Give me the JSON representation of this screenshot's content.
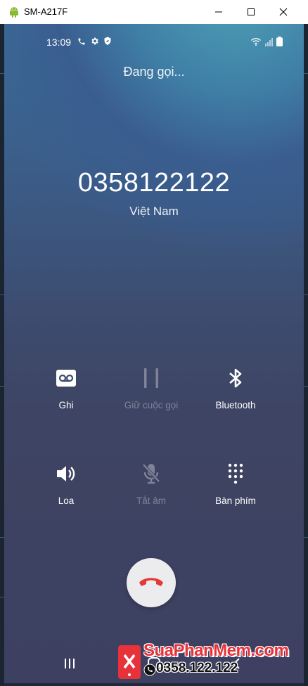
{
  "window": {
    "title": "SM-A217F",
    "icons": [
      "android-icon",
      "minimize-icon",
      "maximize-icon",
      "close-icon"
    ]
  },
  "status_bar": {
    "time": "13:09",
    "icons": [
      "phone-icon",
      "gear-icon",
      "shield-icon",
      "wifi-icon",
      "signal-icon",
      "battery-icon"
    ]
  },
  "call": {
    "state": "Đang gọi...",
    "number": "0358122122",
    "country": "Việt Nam"
  },
  "controls": [
    {
      "label": "Ghi",
      "icon": "voicemail-icon",
      "enabled": true
    },
    {
      "label": "Giữ cuộc gọi",
      "icon": "pause-icon",
      "enabled": false
    },
    {
      "label": "Bluetooth",
      "icon": "bluetooth-icon",
      "enabled": true
    },
    {
      "label": "Loa",
      "icon": "speaker-icon",
      "enabled": true
    },
    {
      "label": "Tắt âm",
      "icon": "mic-off-icon",
      "enabled": false
    },
    {
      "label": "Bàn phím",
      "icon": "keypad-icon",
      "enabled": true
    }
  ],
  "end_call": {
    "icon": "end-call-icon",
    "color": "#e53935"
  },
  "navbar": {
    "icons": [
      "recents-icon",
      "home-icon",
      "back-icon"
    ]
  },
  "watermark": {
    "brand": "SuaPhanMem.com",
    "phone": "0358.122.122",
    "color": "#e8323a"
  }
}
